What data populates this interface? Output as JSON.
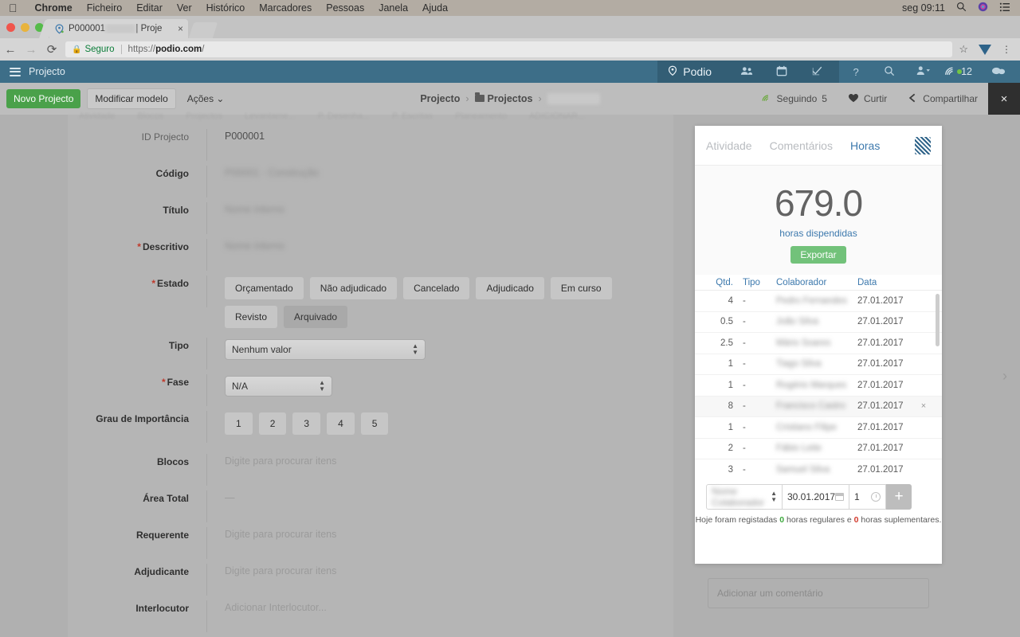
{
  "os_menu": {
    "apple_icon": "apple-icon",
    "items": [
      "Chrome",
      "Ficheiro",
      "Editar",
      "Ver",
      "Histórico",
      "Marcadores",
      "Pessoas",
      "Janela",
      "Ajuda"
    ],
    "clock": "seg 09:11",
    "right_icons": [
      "search-icon",
      "siri-icon",
      "control-center-icon"
    ]
  },
  "browser": {
    "tab": {
      "favicon": "podio-favicon",
      "title_prefix": "P000001",
      "title_redacted": "            ",
      "title_suffix": "| Proje",
      "close_label": "×"
    },
    "new_tab_label": "",
    "back_label": "←",
    "forward_label": "→",
    "reload_label": "⟳",
    "security_label": "Seguro",
    "url_scheme": "https://",
    "url_host": "podio.com",
    "url_path": "/",
    "bookmark_icon": "star-icon",
    "extension_icon": "funnel-extension-icon",
    "menu_icon": "kebab-menu-icon"
  },
  "podio_nav": {
    "menu_icon": "hamburger-icon",
    "workspace": "Projecto",
    "brand": "Podio",
    "brand_icon": "podio-logo-icon",
    "icons": [
      "people-icon",
      "calendar-icon",
      "tasks-icon"
    ],
    "right": {
      "help": "?",
      "search_icon": "search-icon",
      "user_icon": "user-dropdown-icon",
      "feed_icon": "activity-feed-icon",
      "feed_count": "12",
      "chat_icon": "chat-bubble-icon"
    }
  },
  "toolbar": {
    "new_project": "Novo Projecto",
    "modify_template": "Modificar modelo",
    "actions": "Ações ⌄",
    "breadcrumb": {
      "root": "Projecto",
      "folder": "Projectos",
      "current_redacted": "                   ",
      "separator": "›"
    },
    "following_label": "Seguindo",
    "following_count": "5",
    "like_label": "Curtir",
    "share_label": "Compartilhar",
    "close_label": "×"
  },
  "background_tabs": [
    "Atividade",
    "Blocos",
    "Projectos",
    "Levantame...",
    "P. Desenha...",
    "P. Escritas",
    "Planeamento",
    "ADICIONAR..."
  ],
  "form": {
    "fields": [
      {
        "label": "ID Projecto",
        "required": false,
        "bold": false,
        "type": "text",
        "value": "P000001"
      },
      {
        "label": "Código",
        "required": false,
        "bold": true,
        "type": "blur",
        "value": "P00001 - Construção"
      },
      {
        "label": "Título",
        "required": false,
        "bold": true,
        "type": "blur",
        "value": "Nome interno"
      },
      {
        "label": "Descritivo",
        "required": true,
        "bold": true,
        "type": "blur",
        "value": "Nome interno"
      },
      {
        "label": "Estado",
        "required": true,
        "bold": true,
        "type": "chips"
      },
      {
        "label": "Tipo",
        "required": false,
        "bold": true,
        "type": "select-wide",
        "value": "Nenhum valor"
      },
      {
        "label": "Fase",
        "required": true,
        "bold": true,
        "type": "select-narrow",
        "value": "N/A"
      },
      {
        "label": "Grau de Importância",
        "required": false,
        "bold": true,
        "type": "numbers"
      },
      {
        "label": "Blocos",
        "required": false,
        "bold": true,
        "type": "placeholder",
        "value": "Digite para procurar itens"
      },
      {
        "label": "Área Total",
        "required": false,
        "bold": true,
        "type": "text",
        "value": "—"
      },
      {
        "label": "Requerente",
        "required": false,
        "bold": true,
        "type": "placeholder",
        "value": "Digite para procurar itens"
      },
      {
        "label": "Adjudicante",
        "required": false,
        "bold": true,
        "type": "placeholder",
        "value": "Digite para procurar itens"
      },
      {
        "label": "Interlocutor",
        "required": false,
        "bold": true,
        "type": "placeholder",
        "value": "Adicionar Interlocutor..."
      }
    ],
    "state_options": [
      "Orçamentado",
      "Não adjudicado",
      "Cancelado",
      "Adjudicado",
      "Em curso",
      "Revisto",
      "Arquivado"
    ],
    "state_selected": "Arquivado",
    "importance_options": [
      "1",
      "2",
      "3",
      "4",
      "5"
    ]
  },
  "panel": {
    "tabs": [
      {
        "label": "Atividade",
        "active": false
      },
      {
        "label": "Comentários",
        "active": false
      },
      {
        "label": "Horas",
        "active": true
      }
    ],
    "stripe_icon": "striped-square-icon",
    "hero": {
      "total": "679.0",
      "subtitle": "horas dispendidas",
      "export_label": "Exportar"
    },
    "table": {
      "columns": [
        "Qtd.",
        "Tipo",
        "Colaborador",
        "Data"
      ],
      "rows": [
        {
          "qtd": "4",
          "tipo": "-",
          "colaborador": "Pedro Fernandes",
          "data": "27.01.2017",
          "hover": false
        },
        {
          "qtd": "0.5",
          "tipo": "-",
          "colaborador": "João Silva",
          "data": "27.01.2017",
          "hover": false
        },
        {
          "qtd": "2.5",
          "tipo": "-",
          "colaborador": "Mário Soares",
          "data": "27.01.2017",
          "hover": false
        },
        {
          "qtd": "1",
          "tipo": "-",
          "colaborador": "Tiago Silva",
          "data": "27.01.2017",
          "hover": false
        },
        {
          "qtd": "1",
          "tipo": "-",
          "colaborador": "Rogério Marques",
          "data": "27.01.2017",
          "hover": false
        },
        {
          "qtd": "8",
          "tipo": "-",
          "colaborador": "Francisco Castro",
          "data": "27.01.2017",
          "hover": true
        },
        {
          "qtd": "1",
          "tipo": "-",
          "colaborador": "Cristiano Filipe",
          "data": "27.01.2017",
          "hover": false
        },
        {
          "qtd": "2",
          "tipo": "-",
          "colaborador": "Fábio Leite",
          "data": "27.01.2017",
          "hover": false
        },
        {
          "qtd": "3",
          "tipo": "-",
          "colaborador": "Samuel Silva",
          "data": "27.01.2017",
          "hover": false
        }
      ],
      "delete_label": "×"
    },
    "entry": {
      "collaborator_value": "Nome Colaborador",
      "date_value": "30.01.2017",
      "date_icon": "calendar-icon",
      "qty_value": "1",
      "qty_icon": "clock-icon",
      "add_label": "+",
      "hint_prefix": "Hoje foram registadas",
      "hint_regular_count": "0",
      "hint_regular_text": "horas regulares e",
      "hint_extra_count": "0",
      "hint_extra_text": "horas suplementares."
    },
    "comment_placeholder": "Adicionar um comentário"
  },
  "edge": {
    "next_label": "›"
  },
  "colors": {
    "nav_blue": "#3d6e88",
    "nav_blue_dark": "#335e75",
    "accent_green": "#4aa14a",
    "export_green": "#72c27a",
    "link_blue": "#3d79ad",
    "required_red": "#c0392b",
    "count_green": "#3fa93f",
    "count_red": "#d23b2e"
  }
}
